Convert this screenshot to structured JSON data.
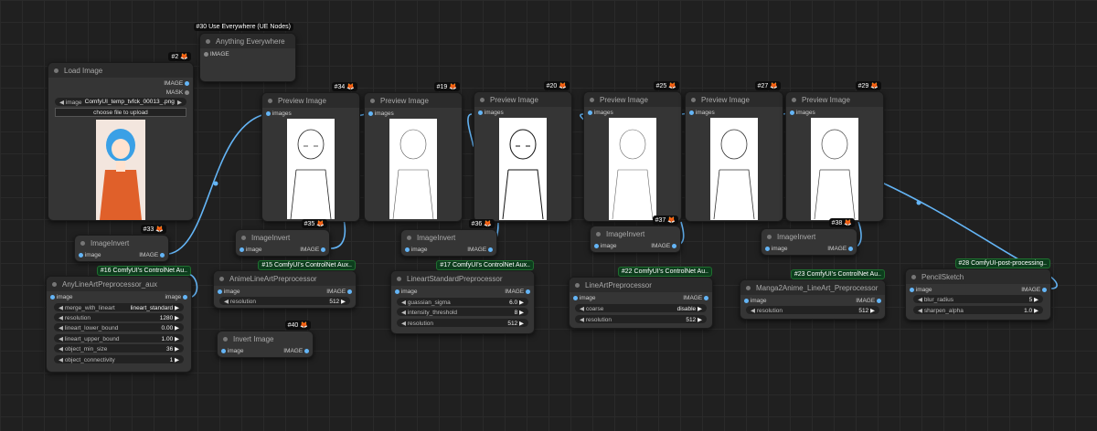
{
  "nodes": {
    "use_everywhere": {
      "badge": "#30 Use Everywhere (UE Nodes)",
      "title": "Anything Everywhere",
      "input": "IMAGE"
    },
    "load_image": {
      "badge": "#2",
      "title": "Load Image",
      "out1": "IMAGE",
      "out2": "MASK",
      "widget_label": "image",
      "widget_value": "ComfyUI_temp_tvfck_00013_.png",
      "upload": "choose file to upload"
    },
    "preview34": {
      "badge": "#34",
      "title": "Preview Image",
      "input": "images"
    },
    "preview19": {
      "badge": "#19",
      "title": "Preview Image",
      "input": "images"
    },
    "preview20": {
      "badge": "#20",
      "title": "Preview Image",
      "input": "images"
    },
    "preview25": {
      "badge": "#25",
      "title": "Preview Image",
      "input": "images"
    },
    "preview27": {
      "badge": "#27",
      "title": "Preview Image",
      "input": "images"
    },
    "preview29": {
      "badge": "#29",
      "title": "Preview Image",
      "input": "images"
    },
    "inv33": {
      "badge": "#33",
      "title": "ImageInvert",
      "in": "image",
      "out": "IMAGE"
    },
    "inv35": {
      "badge": "#35",
      "title": "ImageInvert",
      "in": "image",
      "out": "IMAGE"
    },
    "inv36": {
      "badge": "#36",
      "title": "ImageInvert",
      "in": "image",
      "out": "IMAGE"
    },
    "inv37": {
      "badge": "#37",
      "title": "ImageInvert",
      "in": "image",
      "out": "IMAGE"
    },
    "inv38": {
      "badge": "#38",
      "title": "ImageInvert",
      "in": "image",
      "out": "IMAGE"
    },
    "invert40": {
      "badge": "#40",
      "title": "Invert Image",
      "in": "image",
      "out": "IMAGE"
    },
    "anyline": {
      "badge": "#16 ComfyUI's ControlNet Au..",
      "title": "AnyLineArtPreprocessor_aux",
      "in": "image",
      "out": "image",
      "widgets": [
        {
          "label": "merge_with_lineart",
          "value": "lineart_standard"
        },
        {
          "label": "resolution",
          "value": "1280"
        },
        {
          "label": "lineart_lower_bound",
          "value": "0.00"
        },
        {
          "label": "lineart_upper_bound",
          "value": "1.00"
        },
        {
          "label": "object_min_size",
          "value": "36"
        },
        {
          "label": "object_connectivity",
          "value": "1"
        }
      ]
    },
    "anime": {
      "badge": "#15 ComfyUI's ControlNet Aux..",
      "title": "AnimeLineArtPreprocessor",
      "in": "image",
      "out": "IMAGE",
      "widgets": [
        {
          "label": "resolution",
          "value": "512"
        }
      ]
    },
    "lineart_std": {
      "badge": "#17 ComfyUI's ControlNet Aux..",
      "title": "LineartStandardPreprocessor",
      "in": "image",
      "out": "IMAGE",
      "widgets": [
        {
          "label": "guassian_sigma",
          "value": "6.0"
        },
        {
          "label": "intensity_threshold",
          "value": "8"
        },
        {
          "label": "resolution",
          "value": "512"
        }
      ]
    },
    "lineart": {
      "badge": "#22 ComfyUI's ControlNet Au..",
      "title": "LineArtPreprocessor",
      "in": "image",
      "out": "IMAGE",
      "widgets": [
        {
          "label": "coarse",
          "value": "disable"
        },
        {
          "label": "resolution",
          "value": "512"
        }
      ]
    },
    "manga": {
      "badge": "#23 ComfyUI's ControlNet Au..",
      "title": "Manga2Anime_LineArt_Preprocessor",
      "in": "image",
      "out": "IMAGE",
      "widgets": [
        {
          "label": "resolution",
          "value": "512"
        }
      ]
    },
    "pencil": {
      "badge": "#28 ComfyUI-post-processing..",
      "title": "PencilSketch",
      "in": "image",
      "out": "IMAGE",
      "widgets": [
        {
          "label": "blur_radius",
          "value": "5"
        },
        {
          "label": "sharpen_alpha",
          "value": "1.0"
        }
      ]
    }
  },
  "colors": {
    "wire": "#64b5f6",
    "bg": "#202020",
    "node": "#353535",
    "ctl_badge": "#0d3d1d"
  }
}
